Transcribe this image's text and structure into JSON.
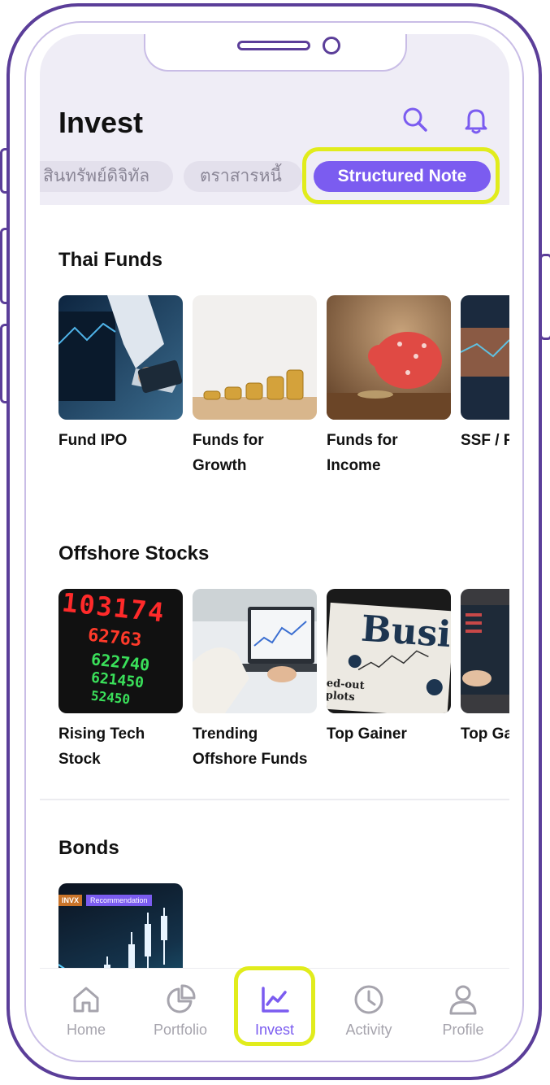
{
  "header": {
    "title": "Invest",
    "search_icon": "search-icon",
    "bell_icon": "bell-icon"
  },
  "chips": [
    {
      "label": "สินทรัพย์ดิจิทัล",
      "active": false
    },
    {
      "label": "ตราสารหนี้",
      "active": false
    },
    {
      "label": "Structured Note",
      "active": true
    }
  ],
  "sections": {
    "thai_funds": {
      "title": "Thai Funds",
      "cards": [
        {
          "line1": "Fund IPO",
          "line2": ""
        },
        {
          "line1": "Funds for",
          "line2": "Growth"
        },
        {
          "line1": "Funds for",
          "line2": "Income"
        },
        {
          "line1": "SSF / R",
          "line2": ""
        }
      ]
    },
    "offshore_stocks": {
      "title": "Offshore Stocks",
      "cards": [
        {
          "line1": "Rising Tech",
          "line2": "Stock"
        },
        {
          "line1": "Trending",
          "line2": "Offshore Funds"
        },
        {
          "line1": "Top Gainer",
          "line2": ""
        },
        {
          "line1": "Top Ga",
          "line2": ""
        }
      ],
      "ticker_text": "103174",
      "ticker_rows": [
        "62763",
        "622740",
        "621450",
        "52450"
      ],
      "newspaper_text": "Busi",
      "newspaper_sub": "ed-out plots"
    },
    "bonds": {
      "title": "Bonds",
      "badge_brand": "INVX",
      "badge_text": "Recommendation"
    }
  },
  "tabs": [
    {
      "label": "Home",
      "icon": "home-icon"
    },
    {
      "label": "Portfolio",
      "icon": "pie-chart-icon"
    },
    {
      "label": "Invest",
      "icon": "trend-chart-icon"
    },
    {
      "label": "Activity",
      "icon": "clock-icon"
    },
    {
      "label": "Profile",
      "icon": "user-icon"
    }
  ],
  "colors": {
    "accent": "#7b5cf0",
    "highlight": "#e1ec1c",
    "frame": "#5b3e99"
  }
}
